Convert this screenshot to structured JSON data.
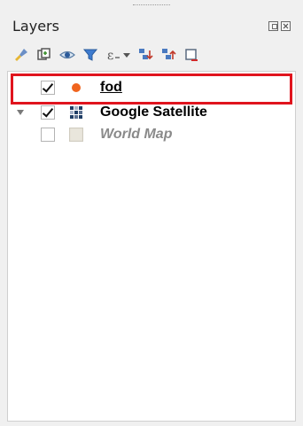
{
  "panel": {
    "title": "Layers",
    "dock_buttons": [
      "float-icon",
      "close-icon"
    ]
  },
  "toolbar": {
    "icons": [
      "style-brush-icon",
      "add-group-icon",
      "manage-visibility-eye-icon",
      "filter-legend-icon",
      "filter-expression-icon",
      "expand-all-icon",
      "collapse-all-icon",
      "remove-layer-icon"
    ]
  },
  "layers": [
    {
      "name": "fod",
      "checked": true,
      "symbol": "orange-point-icon",
      "expandable": false,
      "selected": true,
      "style": "underline"
    },
    {
      "name": "Google Satellite",
      "checked": true,
      "symbol": "raster-tiles-icon",
      "expandable": true,
      "selected": false,
      "style": "bold"
    },
    {
      "name": "World Map",
      "checked": false,
      "symbol": "raster-placeholder-icon",
      "expandable": false,
      "selected": false,
      "style": "italic-grey"
    }
  ],
  "colors": {
    "highlight_border": "#e0141e",
    "point_fill": "#f0641e"
  }
}
